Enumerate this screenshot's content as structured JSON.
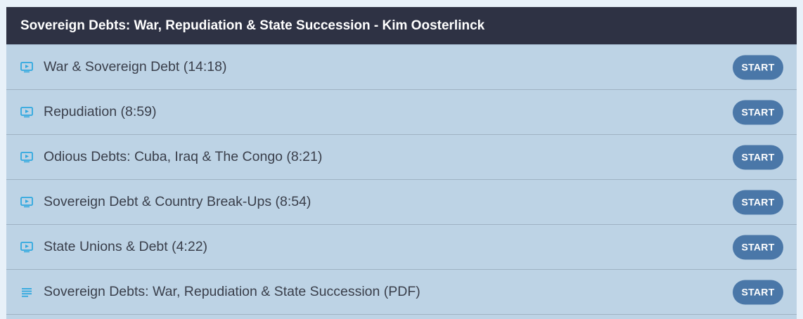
{
  "section": {
    "title": "Sovereign Debts: War, Repudiation & State Succession - Kim Oosterlinck"
  },
  "colors": {
    "header_bg": "#2e3244",
    "list_bg": "#bdd3e5",
    "icon": "#2fa8df",
    "button": "#4a77a8"
  },
  "lectures": [
    {
      "title": "War & Sovereign Debt (14:18)",
      "icon": "video-icon",
      "button": "START"
    },
    {
      "title": "Repudiation (8:59)",
      "icon": "video-icon",
      "button": "START"
    },
    {
      "title": "Odious Debts: Cuba, Iraq & The Congo (8:21)",
      "icon": "video-icon",
      "button": "START"
    },
    {
      "title": "Sovereign Debt & Country Break-Ups (8:54)",
      "icon": "video-icon",
      "button": "START"
    },
    {
      "title": "State Unions & Debt (4:22)",
      "icon": "video-icon",
      "button": "START"
    },
    {
      "title": "Sovereign Debts: War, Repudiation & State Succession (PDF)",
      "icon": "document-icon",
      "button": "START"
    }
  ]
}
